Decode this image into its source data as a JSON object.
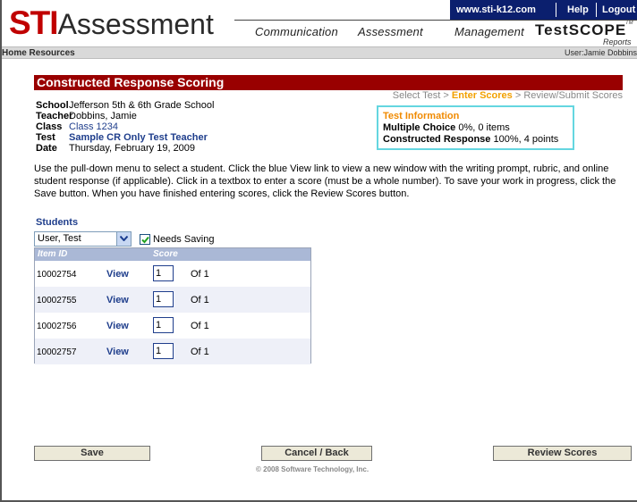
{
  "header": {
    "logo_sti": "STI",
    "logo_assessment": "Assessment",
    "top_links": [
      "www.sti-k12.com",
      "Help",
      "Logout"
    ],
    "tabs": [
      "Communication",
      "Assessment",
      "Management"
    ],
    "testscope": "TestSCOPE",
    "testscope_tm": "TM",
    "testscope_sub": "Reports",
    "nav_bg": "#0b1f6e",
    "brand_red": "#c00000"
  },
  "subbar": {
    "home_resources": "Home Resources",
    "user": "User:Jamie Dobbins"
  },
  "page": {
    "title": "Constructed Response Scoring",
    "breadcrumb": {
      "step1": "Select Test",
      "sep": ">",
      "step2": "Enter Scores",
      "step3": "Review/Submit Scores"
    }
  },
  "info": {
    "school_label": "School",
    "school": "Jefferson 5th & 6th Grade School",
    "teacher_label": "Teacher",
    "teacher": "Dobbins, Jamie",
    "class_label": "Class",
    "class": "Class 1234",
    "test_label": "Test",
    "test": "Sample CR Only Test Teacher",
    "date_label": "Date",
    "date": "Thursday, February 19, 2009"
  },
  "test_info": {
    "title": "Test Information",
    "mc_label": "Multiple Choice",
    "mc_value": "0%, 0 items",
    "cr_label": "Constructed Response",
    "cr_value": "100%, 4 points"
  },
  "instructions": "Use the pull-down menu to select a student. Click the blue View link to view a new window with the writing prompt, rubric, and online student response (if applicable). Click in a textbox to enter a score (must be a whole number). To save your work in progress, click the Save button. When you have finished entering scores, click the Review Scores button.",
  "students": {
    "label": "Students",
    "selected": "User, Test",
    "needs_saving_label": "Needs Saving",
    "needs_saving_checked": true
  },
  "grid": {
    "headers": [
      "Item ID",
      "Score"
    ],
    "rows": [
      {
        "id": "10002754",
        "view": "View",
        "score": "1",
        "of": "Of 1"
      },
      {
        "id": "10002755",
        "view": "View",
        "score": "1",
        "of": "Of 1"
      },
      {
        "id": "10002756",
        "view": "View",
        "score": "1",
        "of": "Of 1"
      },
      {
        "id": "10002757",
        "view": "View",
        "score": "1",
        "of": "Of 1"
      }
    ]
  },
  "buttons": {
    "save": "Save",
    "cancel": "Cancel / Back",
    "review": "Review Scores"
  },
  "footer": {
    "copyright": "© 2008 Software Technology, Inc."
  }
}
